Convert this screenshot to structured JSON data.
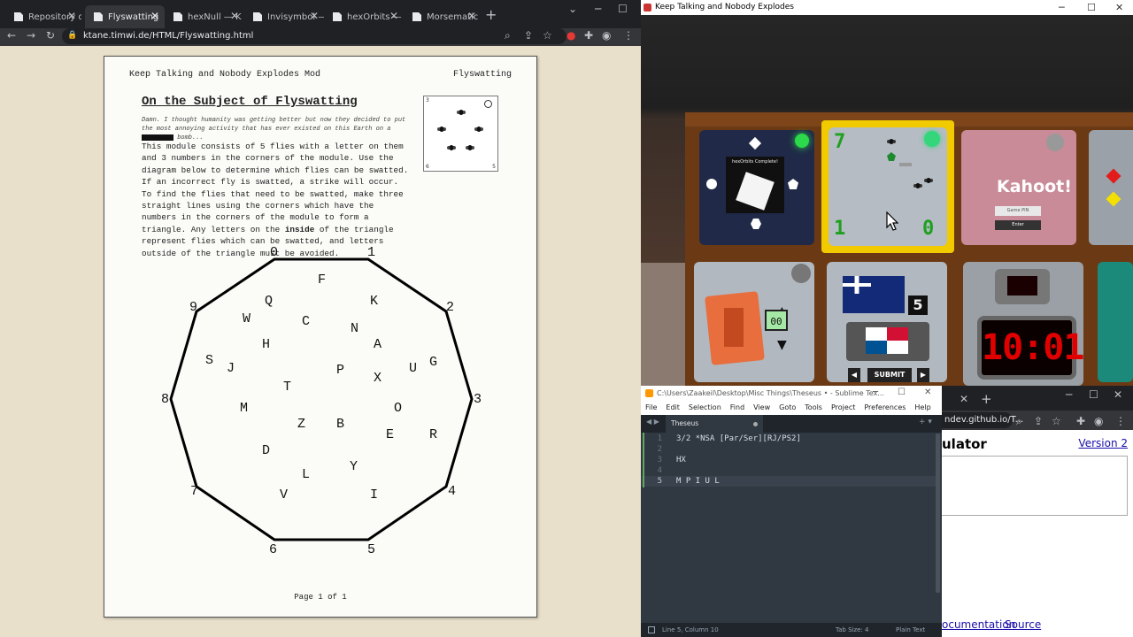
{
  "browser": {
    "tabs": [
      {
        "label": "Repository of"
      },
      {
        "label": "Flyswatting"
      },
      {
        "label": "hexNull — K"
      },
      {
        "label": "Invisymbol —"
      },
      {
        "label": "hexOrbits —"
      },
      {
        "label": "Morsematic"
      }
    ],
    "new_tab": "+",
    "url": "ktane.timwi.de/HTML/Flyswatting.html"
  },
  "manual": {
    "header_left": "Keep Talking and Nobody Explodes Mod",
    "header_right": "Flyswatting",
    "title": "On the Subject of Flyswatting",
    "flavor_a": "Damn. I thought humanity was getting better but now they decided to put the most annoying activity that has ever existed on this Earth on a",
    "flavor_b": "bomb...",
    "body_1": "This module consists of 5 flies with a letter on them and 3 numbers in the corners of the module. Use the diagram below to determine which flies can be swatted. If an incorrect fly is swatted, a strike will occur. To find the flies that need to be swatted, make three straight lines using the corners which have the numbers in the corners of the module to form a triangle. Any letters on the",
    "body_bold": "inside",
    "body_2": "of the triangle represent flies which can be swatted, and letters outside of the triangle must be avoided.",
    "thumb_nums": [
      "3",
      "6",
      "5"
    ],
    "diagram_corners": [
      "0",
      "1",
      "2",
      "3",
      "4",
      "5",
      "6",
      "7",
      "8",
      "9"
    ],
    "diagram_letters": [
      "F",
      "Q",
      "K",
      "W",
      "C",
      "N",
      "H",
      "A",
      "S",
      "J",
      "P",
      "U",
      "G",
      "X",
      "T",
      "M",
      "O",
      "Z",
      "B",
      "R",
      "E",
      "D",
      "Y",
      "L",
      "V",
      "I"
    ],
    "footer": "Page 1 of 1"
  },
  "game": {
    "title": "Keep Talking and Nobody Explodes",
    "orbit_label": "hexOrbits Complete!",
    "fly_nums": [
      "7",
      "1",
      "0"
    ],
    "kahoot_title": "Kahoot!",
    "kahoot_pin": "Game PIN",
    "kahoot_enter": "Enter",
    "seg_display": "00",
    "flag_number": "5",
    "submit": "SUBMIT",
    "timer": "10:01"
  },
  "sublime": {
    "title": "C:\\Users\\Zaakeil\\Desktop\\Misc Things\\Theseus • - Sublime Tex...",
    "menu": [
      "File",
      "Edit",
      "Selection",
      "Find",
      "View",
      "Goto",
      "Tools",
      "Project",
      "Preferences",
      "Help"
    ],
    "tab": "Theseus",
    "line_numbers": [
      "1",
      "2",
      "3",
      "4",
      "5"
    ],
    "lines": [
      "3/2 *NSA [Par/Ser][RJ/PS2]",
      "",
      "HX",
      "",
      "M P I U L"
    ],
    "status_left": "Line 5, Column 10",
    "status_mid": "Tab Size: 4",
    "status_right": "Plain Text"
  },
  "browser2": {
    "url": "ndev.github.io/T...",
    "heading": "ulator",
    "version": "Version 2",
    "link_doc": "ocumentation",
    "link_src": "Source"
  }
}
